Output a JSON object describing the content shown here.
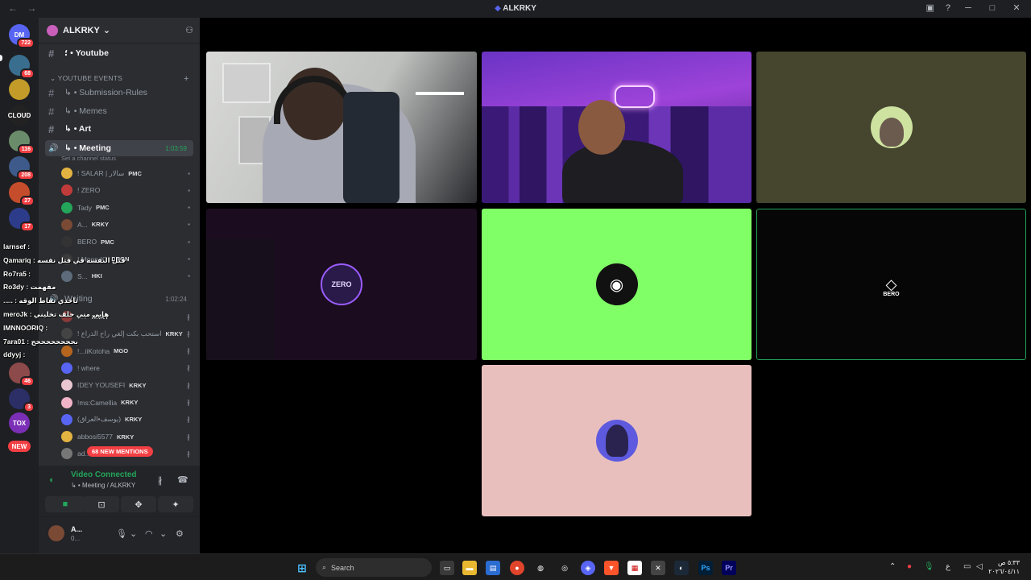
{
  "window": {
    "title": "ALKRKY"
  },
  "servers": [
    {
      "label": "DM",
      "badge": "722",
      "color": "#5865f2"
    },
    {
      "label": "",
      "badge": "68",
      "color": "#3a6e8e"
    },
    {
      "label": "",
      "badge": "",
      "color": "#c29b28"
    },
    {
      "label": "CLOUD",
      "badge": "",
      "color": "#222"
    },
    {
      "label": "",
      "badge": "116",
      "color": "#6b8c6b"
    },
    {
      "label": "",
      "badge": "208",
      "color": "#3d5a8a"
    },
    {
      "label": "",
      "badge": "27",
      "color": "#c54d2b"
    },
    {
      "label": "",
      "badge": "17",
      "color": "#2d3c8a"
    },
    {
      "label": "",
      "badge": "46",
      "color": "#8d4a4a"
    },
    {
      "label": "",
      "badge": "3",
      "color": "#2b2f66"
    },
    {
      "label": "TOX",
      "badge": "",
      "color": "#7b2fb6"
    },
    {
      "label": "NEW",
      "badge": "",
      "color": "#f23f43"
    }
  ],
  "guild": {
    "name": "ALKRKY"
  },
  "channels": [
    {
      "name": "؛ • Youtube",
      "type": "text",
      "style": "bright"
    },
    {
      "name": "YOUTUBE EVENTS",
      "type": "category"
    },
    {
      "name": "↳ • Submission-Rules",
      "type": "text",
      "style": ""
    },
    {
      "name": "↳ • Memes",
      "type": "text",
      "style": ""
    },
    {
      "name": "↳ • Art",
      "type": "text",
      "style": "bright"
    },
    {
      "name": "↳ • Meeting",
      "type": "voice",
      "style": "active",
      "time": "1:03:59"
    }
  ],
  "channel_status": "Set a channel status",
  "voice_users": [
    {
      "name": "! SALAR | سالار",
      "tag": "PMC",
      "color": "#e3b341"
    },
    {
      "name": "! ZERO",
      "tag": "",
      "color": "#c23b3b"
    },
    {
      "name": "Tady",
      "tag": "PMC",
      "color": "#23a55a"
    },
    {
      "name": "A...",
      "tag": "KRKY",
      "color": "#7a4a34"
    },
    {
      "name": "BERO",
      "tag": "PMC",
      "color": "#333"
    },
    {
      "name": "! Moon IQ",
      "tag": "DRGN",
      "color": "#3a3a3a"
    },
    {
      "name": "S...",
      "tag": "HKI",
      "color": "#5d6b7a"
    }
  ],
  "waiting": {
    "name": "Waiting",
    "time": "1:02:24"
  },
  "waiting_users": [
    {
      "name": "...Y",
      "tag": "KRKY",
      "color": "#8a3a3a"
    },
    {
      "name": "! استحب بكت إلغي راح الذراع",
      "tag": "KRKY",
      "color": "#444"
    },
    {
      "name": "!...iiKotoha",
      "tag": "MGO",
      "color": "#b5651d"
    },
    {
      "name": "! where",
      "tag": "",
      "color": "#5865f2"
    },
    {
      "name": "IDEY YOUSEFI",
      "tag": "KRKY",
      "color": "#e8c7d0"
    },
    {
      "name": "!ms:Camellia",
      "tag": "KRKY",
      "color": "#f0b3c7"
    },
    {
      "name": "(يوسف•العراق)",
      "tag": "KRKY",
      "color": "#5865f2"
    },
    {
      "name": "abbosi5577",
      "tag": "KRKY",
      "color": "#e3b341"
    },
    {
      "name": "ad...",
      "tag": "",
      "color": "#777"
    }
  ],
  "mentions_label": "68 NEW MENTIONS",
  "voice_panel": {
    "title": "Video Connected",
    "subtitle": "↳ • Meeting / ALKRKY"
  },
  "user_panel": {
    "name": "A...",
    "status": "0..."
  },
  "tiles": [
    {
      "kind": "camera1"
    },
    {
      "kind": "camera2"
    },
    {
      "kind": "avatar",
      "bg": "#46462f",
      "avatar_color": "#cfe3a1"
    },
    {
      "kind": "avatar",
      "bg": "#1b0d1f",
      "avatar_color": "#2a1a4a",
      "label": "ZERO"
    },
    {
      "kind": "avatar",
      "bg": "#80ff66",
      "avatar_color": "#111111"
    },
    {
      "kind": "avatar",
      "bg": "#060606",
      "avatar_color": "#060606",
      "label": "BERO"
    },
    {
      "kind": "avatar",
      "bg": "#e8bfbd",
      "avatar_color": "#5e5adf"
    }
  ],
  "chat_overlay": [
    "larnsef :",
    "Qamariq : قتل النفسه في قتل نفسه",
    "Ro7ra5 :",
    "Ro3dy : مفهمت",
    "..... : تاخدي نقاط الوقه",
    "meroJk : هايي مني حلف تخليني",
    "IMNNOORIQ :",
    "7ara01 : بححححححححح",
    "ddyyj :"
  ],
  "taskbar": {
    "search_placeholder": "Search",
    "clock_time": "٥:٣٣ ص",
    "clock_date": "٢٠٢٦/٠٤/١١"
  }
}
